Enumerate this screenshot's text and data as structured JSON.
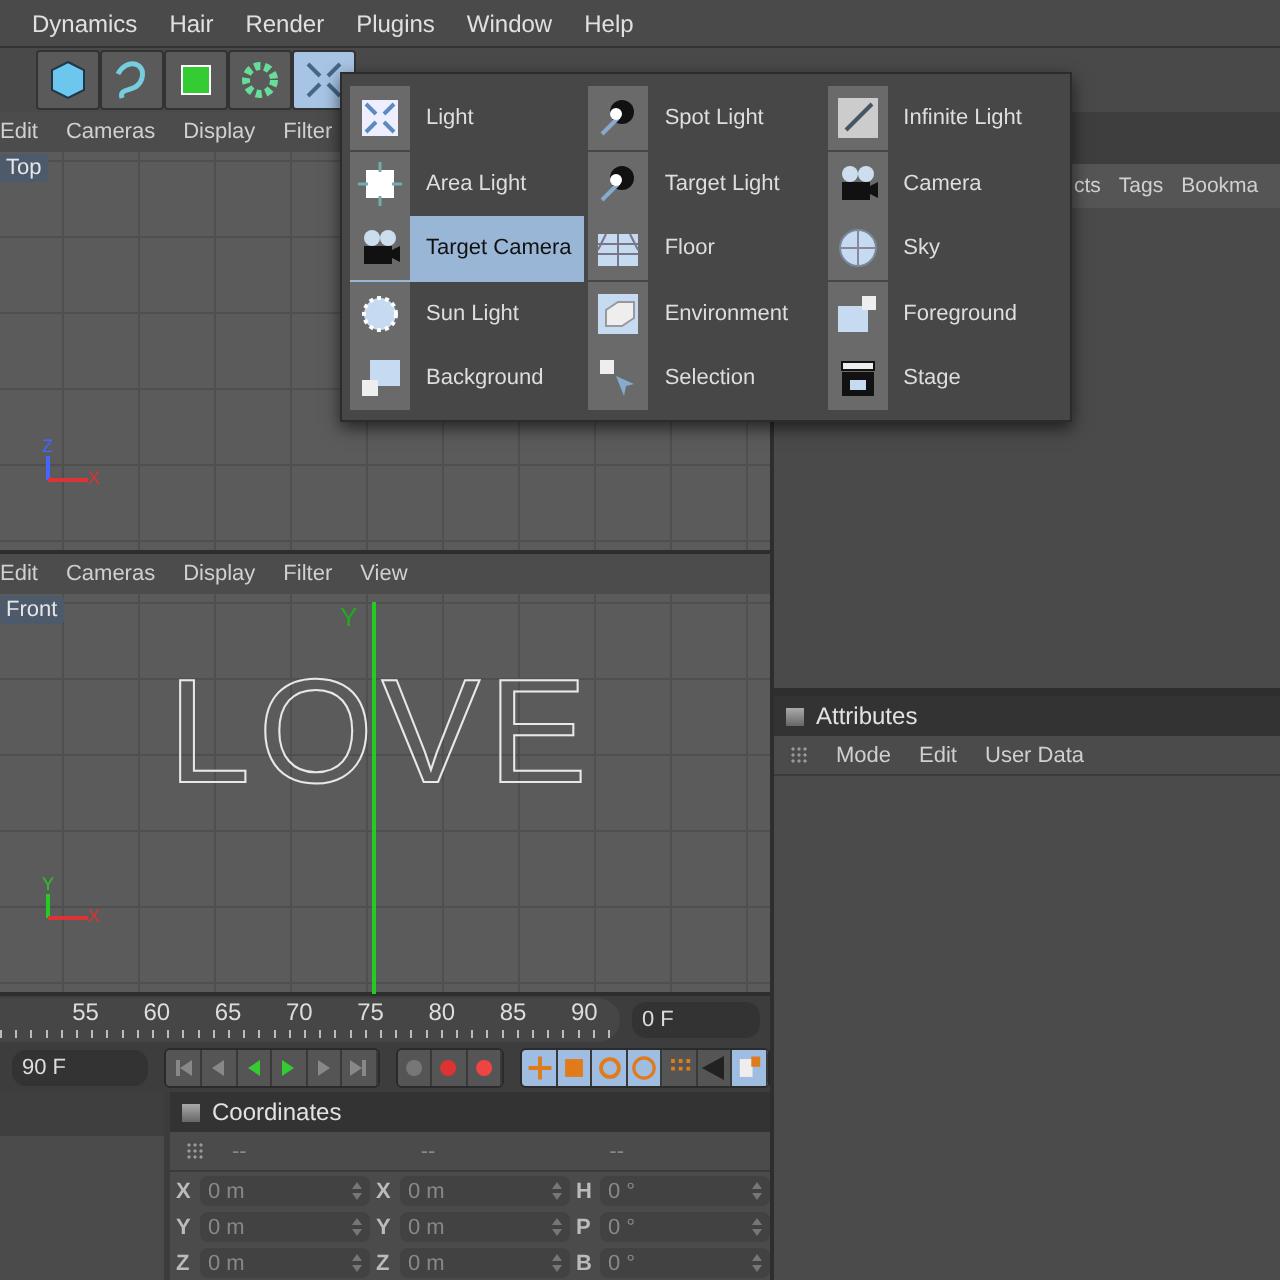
{
  "menu_bar": [
    "Dynamics",
    "Hair",
    "Render",
    "Plugins",
    "Window",
    "Help"
  ],
  "toolbar": [
    {
      "kind": "cube",
      "selected": false
    },
    {
      "kind": "spline",
      "selected": false
    },
    {
      "kind": "nurbs",
      "selected": false
    },
    {
      "kind": "array",
      "selected": false
    },
    {
      "kind": "light",
      "selected": true
    }
  ],
  "viewports": [
    {
      "menu": [
        "Edit",
        "Cameras",
        "Display",
        "Filter"
      ],
      "label": "Top",
      "axes": [
        "Z",
        "X"
      ]
    },
    {
      "menu": [
        "Edit",
        "Cameras",
        "Display",
        "Filter",
        "View"
      ],
      "label": "Front",
      "object_text": "LOVE",
      "axis_label": "Y",
      "axes": [
        "Y",
        "X"
      ]
    }
  ],
  "light_menu": {
    "columns": [
      [
        {
          "label": "Light",
          "kind": "light",
          "selected": false
        },
        {
          "label": "Area Light",
          "kind": "area",
          "selected": false
        },
        {
          "label": "Target Camera",
          "kind": "targetcam",
          "selected": true
        },
        {
          "label": "Sun Light",
          "kind": "sun",
          "selected": false
        },
        {
          "label": "Background",
          "kind": "background",
          "selected": false
        }
      ],
      [
        {
          "label": "Spot Light",
          "kind": "spot",
          "selected": false
        },
        {
          "label": "Target Light",
          "kind": "targetspot",
          "selected": false
        },
        {
          "label": "Floor",
          "kind": "floor",
          "selected": false
        },
        {
          "label": "Environment",
          "kind": "environment",
          "selected": false
        },
        {
          "label": "Selection",
          "kind": "selection",
          "selected": false
        }
      ],
      [
        {
          "label": "Infinite Light",
          "kind": "infinite",
          "selected": false
        },
        {
          "label": "Camera",
          "kind": "camera",
          "selected": false
        },
        {
          "label": "Sky",
          "kind": "sky",
          "selected": false
        },
        {
          "label": "Foreground",
          "kind": "foreground",
          "selected": false
        },
        {
          "label": "Stage",
          "kind": "stage",
          "selected": false
        }
      ]
    ]
  },
  "object_manager": {
    "menu": [
      "cts",
      "Tags",
      "Bookma"
    ]
  },
  "attributes": {
    "title": "Attributes",
    "menu": [
      "Mode",
      "Edit",
      "User Data"
    ]
  },
  "timeline": {
    "ticks": [
      "55",
      "60",
      "65",
      "70",
      "75",
      "80",
      "85",
      "90"
    ],
    "current_frame": "0 F"
  },
  "transport": {
    "end_frame": "90 F",
    "tools": [
      {
        "kind": "move",
        "selected": true
      },
      {
        "kind": "scale",
        "selected": true
      },
      {
        "kind": "rotate",
        "selected": true
      },
      {
        "kind": "param",
        "selected": true
      },
      {
        "kind": "grid",
        "selected": false
      },
      {
        "kind": "sound",
        "selected": false
      },
      {
        "kind": "layout",
        "selected": true
      }
    ]
  },
  "coordinates": {
    "title": "Coordinates",
    "headers": [
      "--",
      "--",
      "--"
    ],
    "rows": [
      [
        {
          "axis": "X",
          "value": "0 m"
        },
        {
          "axis": "X",
          "value": "0 m"
        },
        {
          "axis": "H",
          "value": "0 °"
        }
      ],
      [
        {
          "axis": "Y",
          "value": "0 m"
        },
        {
          "axis": "Y",
          "value": "0 m"
        },
        {
          "axis": "P",
          "value": "0 °"
        }
      ],
      [
        {
          "axis": "Z",
          "value": "0 m"
        },
        {
          "axis": "Z",
          "value": "0 m"
        },
        {
          "axis": "B",
          "value": "0 °"
        }
      ]
    ]
  }
}
